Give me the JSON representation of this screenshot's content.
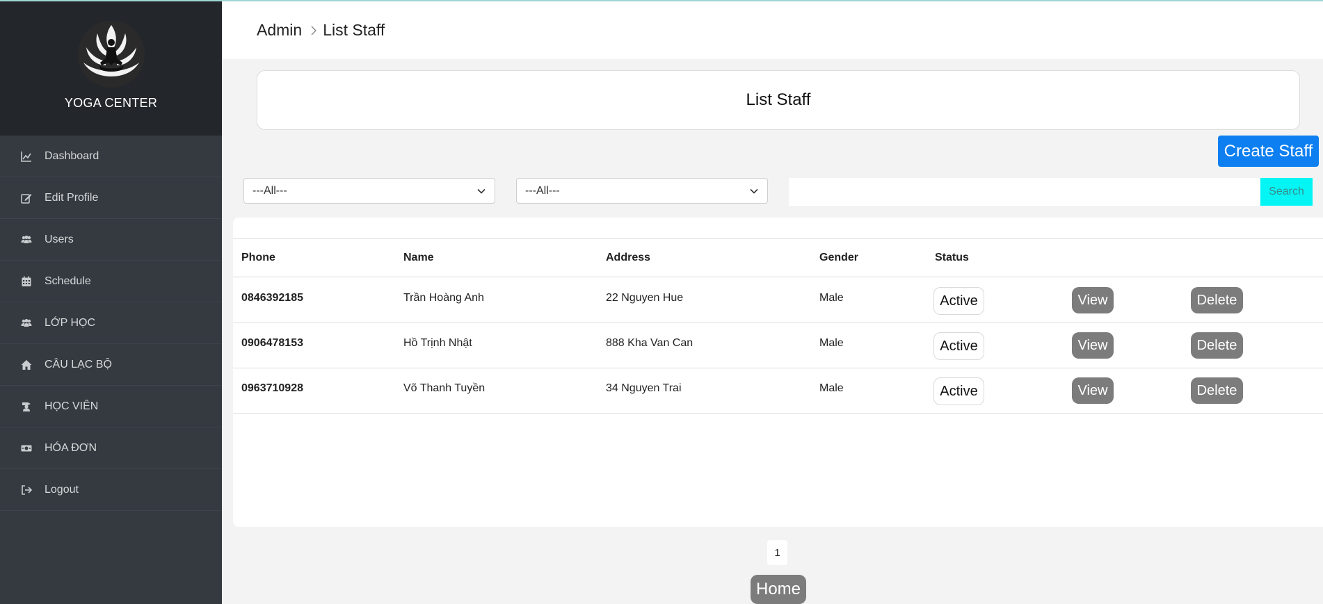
{
  "brand": {
    "name": "YOGA CENTER",
    "logo_icon": "yoga-lotus-logo"
  },
  "sidebar": {
    "items": [
      {
        "label": "Dashboard",
        "icon": "chart-line-icon"
      },
      {
        "label": "Edit Profile",
        "icon": "edit-icon"
      },
      {
        "label": "Users",
        "icon": "users-icon"
      },
      {
        "label": "Schedule",
        "icon": "calendar-icon"
      },
      {
        "label": "LỚP HỌC",
        "icon": "users-icon"
      },
      {
        "label": "CÂU LẠC BỘ",
        "icon": "home-icon"
      },
      {
        "label": "HỌC VIÊN",
        "icon": "student-icon"
      },
      {
        "label": "HÓA ĐƠN",
        "icon": "money-icon"
      },
      {
        "label": "Logout",
        "icon": "logout-icon"
      }
    ]
  },
  "breadcrumb": {
    "root": "Admin",
    "current": "List Staff"
  },
  "page_title": "List Staff",
  "create_button": "Create Staff",
  "filters": {
    "filter1": "---All---",
    "filter2": "---All---"
  },
  "search": {
    "value": "",
    "button": "Search"
  },
  "table": {
    "headers": [
      "Phone",
      "Name",
      "Address",
      "Gender",
      "Status"
    ],
    "rows": [
      {
        "phone": "0846392185",
        "name": "Trần Hoàng Anh",
        "address": "22 Nguyen Hue",
        "gender": "Male",
        "status": "Active",
        "view": "View",
        "delete": "Delete"
      },
      {
        "phone": "0906478153",
        "name": "Hồ Trịnh Nhật",
        "address": "888 Kha Van Can",
        "gender": "Male",
        "status": "Active",
        "view": "View",
        "delete": "Delete"
      },
      {
        "phone": "0963710928",
        "name": "Võ Thanh Tuyền",
        "address": "34 Nguyen Trai",
        "gender": "Male",
        "status": "Active",
        "view": "View",
        "delete": "Delete"
      }
    ]
  },
  "pagination": {
    "current": "1"
  },
  "home_button": "Home",
  "colors": {
    "sidebar": "#343a40",
    "brand_bg": "#23272b",
    "primary": "#0d7ff0",
    "search": "#05f5f5",
    "action": "#7c7c7c"
  }
}
